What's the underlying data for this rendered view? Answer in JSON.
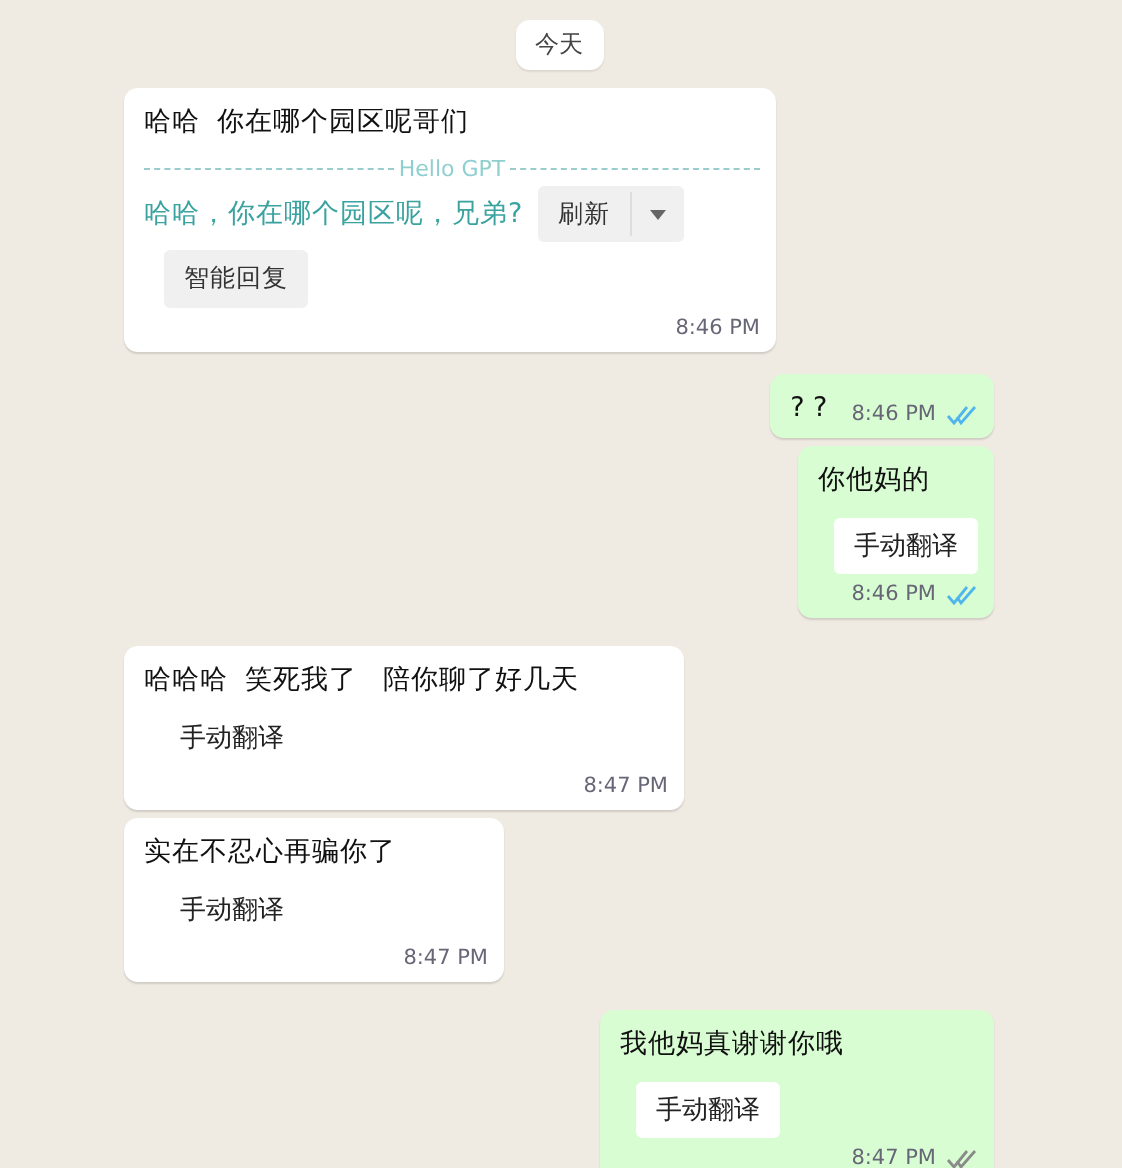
{
  "date_chip": "今天",
  "messages": [
    {
      "kind": "incoming",
      "text": "哈哈  你在哪个园区呢哥们",
      "gpt": {
        "label": "Hello GPT",
        "translation": "哈哈，你在哪个园区呢，兄弟?",
        "refresh": "刷新",
        "reply": "智能回复"
      },
      "time": "8:46 PM"
    },
    {
      "kind": "outgoing",
      "text": "? ?",
      "time": "8:46 PM",
      "read": true
    },
    {
      "kind": "outgoing",
      "text": "你他妈的",
      "translate": "手动翻译",
      "time": "8:46 PM",
      "read": true
    },
    {
      "kind": "incoming",
      "text": "哈哈哈  笑死我了   陪你聊了好几天",
      "translate": "手动翻译",
      "time": "8:47 PM"
    },
    {
      "kind": "incoming",
      "text": "实在不忍心再骗你了",
      "translate": "手动翻译",
      "time": "8:47 PM"
    },
    {
      "kind": "outgoing",
      "text": "我他妈真谢谢你哦",
      "translate": "手动翻译",
      "time": "8:47 PM",
      "read": false
    }
  ]
}
